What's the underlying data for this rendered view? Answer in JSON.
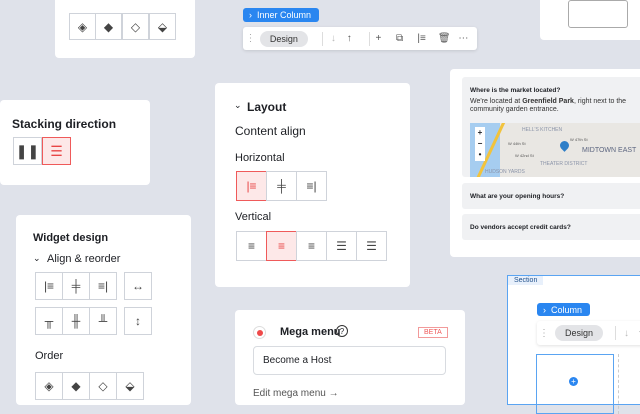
{
  "layers_card": {
    "icons": [
      "layers-icon",
      "layers-filled-icon",
      "layers-outline-icon",
      "layers-top-icon"
    ]
  },
  "stacking": {
    "title": "Stacking direction"
  },
  "widget": {
    "title": "Widget design",
    "section": "Align & reorder",
    "order_label": "Order"
  },
  "layout": {
    "title": "Layout",
    "content_align": "Content align",
    "horizontal": "Horizontal",
    "vertical": "Vertical"
  },
  "inner_column": {
    "tag": "Inner Column",
    "design": "Design"
  },
  "faq": {
    "q1": "Where is the market located?",
    "a1_pre": "We're located at ",
    "a1_bold": "Greenfield Park",
    "a1_post": ", right next to the community garden entrance.",
    "q2": "What are your opening hours?",
    "q3": "Do vendors accept credit cards?",
    "map_labels": [
      "HELL'S KITCHEN",
      "THEATER DISTRICT",
      "MIDTOWN EAST",
      "HUDSON YARDS",
      "W 47th St",
      "W 44th St",
      "W 42nd St"
    ]
  },
  "mega": {
    "title": "Mega menu",
    "badge": "BETA",
    "input_value": "Become a Host",
    "edit_link": "Edit mega menu →"
  },
  "section": {
    "label": "Section",
    "column_tag": "Column",
    "design": "Design"
  },
  "colors": {
    "accent": "#2a86f0",
    "selected": "#ef5a5a"
  }
}
